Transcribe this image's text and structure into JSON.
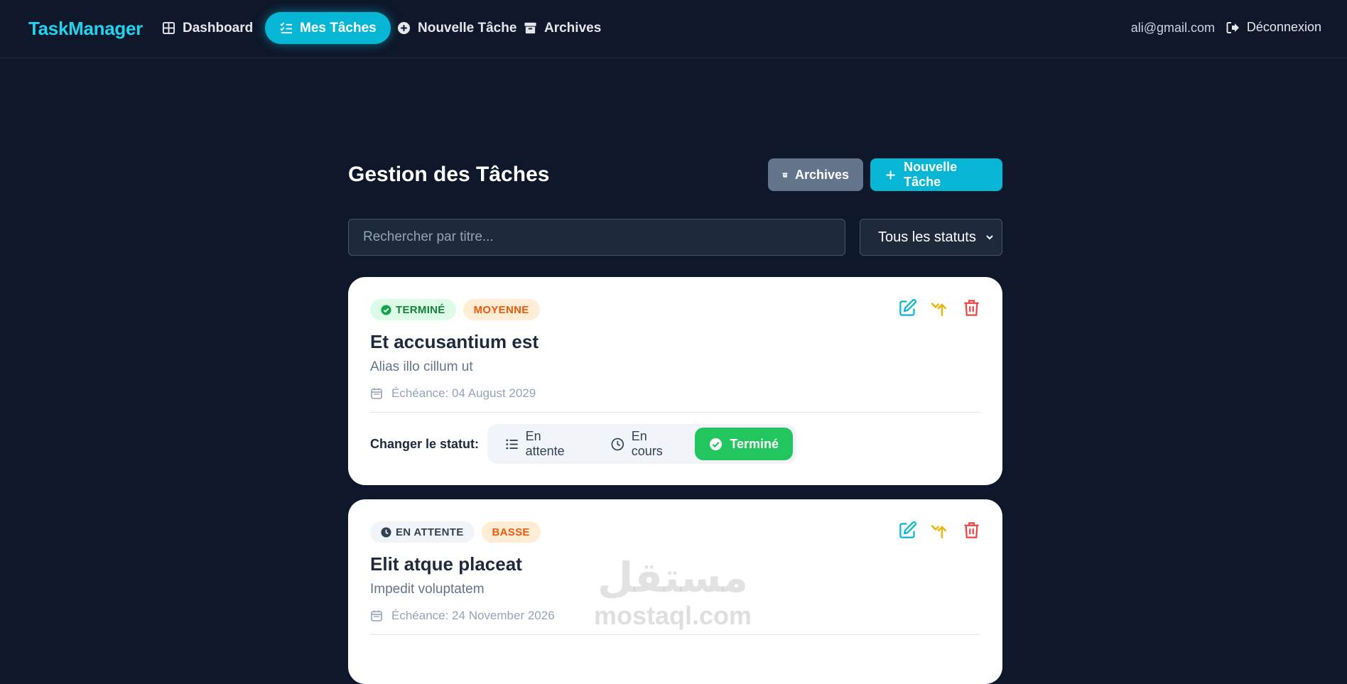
{
  "navbar": {
    "brand": "TaskManager",
    "items": [
      {
        "label": "Dashboard",
        "icon": "dashboard-grid-icon"
      },
      {
        "label": "Mes Tâches",
        "icon": "task-list-icon",
        "active": true
      },
      {
        "label": "Nouvelle Tâche",
        "icon": "plus-circle-icon"
      },
      {
        "label": "Archives",
        "icon": "archive-box-icon"
      }
    ],
    "user_email": "ali@gmail.com",
    "logout_label": "Déconnexion"
  },
  "header": {
    "title": "Gestion des Tâches",
    "archives_label": "Archives",
    "new_task_label": "Nouvelle Tâche"
  },
  "filters": {
    "search_placeholder": "Rechercher par titre...",
    "search_value": "",
    "status_select": "Tous les statuts"
  },
  "tasks": [
    {
      "status_badge": "TERMINÉ",
      "priority_badge": "MOYENNE",
      "title": "Et accusantium est",
      "description": "Alias illo cillum ut",
      "due": "Échéance: 04 August 2029",
      "change_status_label": "Changer le statut:",
      "status_options": [
        "En attente",
        "En cours",
        "Terminé"
      ],
      "active_status": "Terminé"
    },
    {
      "status_badge": "EN ATTENTE",
      "priority_badge": "BASSE",
      "title": "Elit atque placeat",
      "description": "Impedit voluptatem",
      "due": "Échéance: 24 November 2026"
    }
  ],
  "colors": {
    "background": "#0f172a",
    "accent": "#06b6d4",
    "brand": "#22d3ee",
    "success": "#22c55e",
    "priority": "#ea580c",
    "edit_icon": "#06b6d4",
    "archive_icon": "#eab308",
    "delete_icon": "#ef4444"
  },
  "watermark": {
    "arabic": "مستقل",
    "latin": "mostaql.com"
  }
}
